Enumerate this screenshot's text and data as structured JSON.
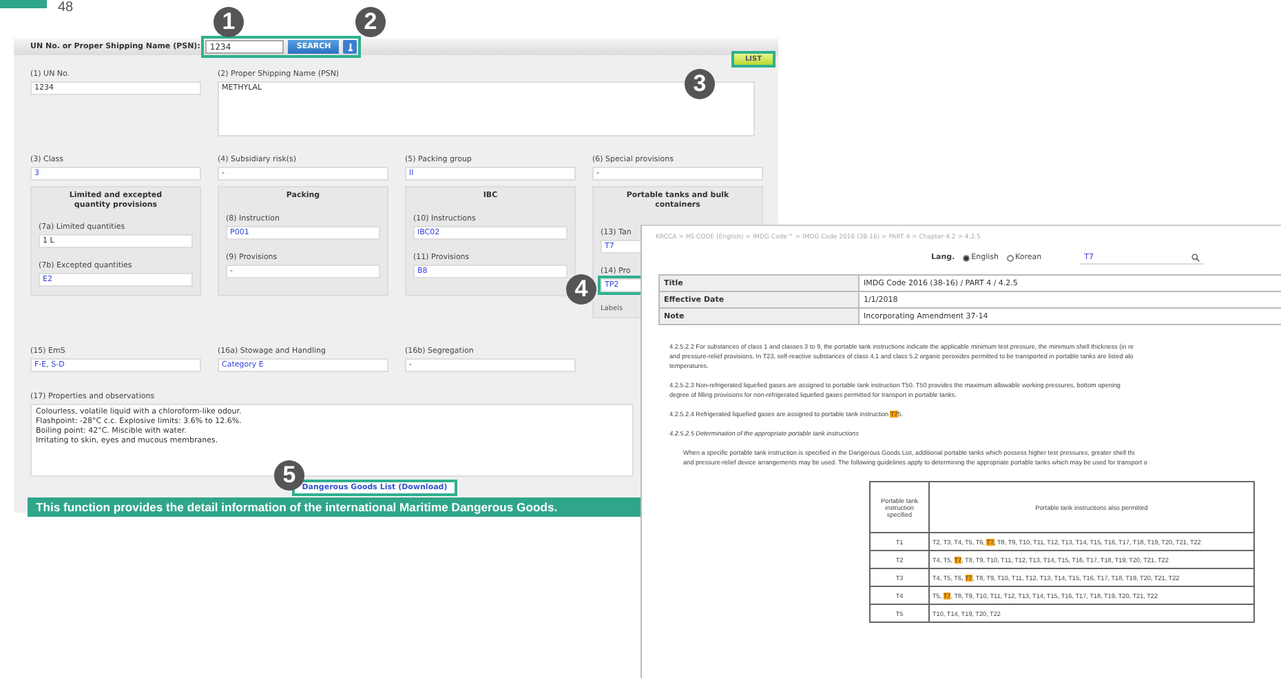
{
  "page_number": "48",
  "callouts": [
    {
      "number": "1"
    },
    {
      "number": "2"
    },
    {
      "number": "3"
    },
    {
      "number": "4"
    },
    {
      "number": "5"
    }
  ],
  "search": {
    "label": "UN No. or Proper Shipping Name (PSN):",
    "value": "1234",
    "button": "SEARCH",
    "framed": true
  },
  "list_button": {
    "label": "LIST",
    "framed": true
  },
  "un_no": {
    "label": "(1) UN No.",
    "value": "1234"
  },
  "psn": {
    "label": "(2) Proper Shipping Name (PSN)",
    "value": "METHYLAL"
  },
  "row_fields": [
    {
      "label": "(3) Class",
      "value": "3",
      "link": true
    },
    {
      "label": "(4) Subsidiary risk(s)",
      "value": "-",
      "link": false
    },
    {
      "label": "(5) Packing group",
      "value": "II",
      "link": true
    },
    {
      "label": "(6) Special provisions",
      "value": "-",
      "link": false
    }
  ],
  "groups": [
    {
      "title": "Limited and excepted quantity provisions",
      "fields": [
        {
          "label": "(7a) Limited quantities",
          "value": "1 L",
          "link": false,
          "framed": false
        },
        {
          "label": "(7b) Excepted quantities",
          "value": "E2",
          "link": true,
          "framed": false
        }
      ]
    },
    {
      "title": "Packing",
      "fields": [
        {
          "label": "(8) Instruction",
          "value": "P001",
          "link": true,
          "framed": false
        },
        {
          "label": "(9) Provisions",
          "value": "-",
          "link": false,
          "framed": false
        }
      ]
    },
    {
      "title": "IBC",
      "fields": [
        {
          "label": "(10) Instructions",
          "value": "IBC02",
          "link": true,
          "framed": false
        },
        {
          "label": "(11) Provisions",
          "value": "B8",
          "link": true,
          "framed": false
        }
      ]
    },
    {
      "title": "Portable tanks and bulk containers",
      "fields": [
        {
          "label": "(13) Tan",
          "value": "T7",
          "link": true,
          "framed": false
        },
        {
          "label": "(14) Pro",
          "value": "TP2",
          "link": true,
          "framed": true
        }
      ],
      "note": "Labels"
    }
  ],
  "bottom_fields": [
    {
      "label": "(15) EmS",
      "value": "F-E, S-D",
      "link": true
    },
    {
      "label": "(16a) Stowage and Handling",
      "value": "Category E",
      "link": true
    },
    {
      "label": "(16b) Segregation",
      "value": "-",
      "link": false
    }
  ],
  "properties": {
    "label": "(17) Properties and observations",
    "lines": [
      "Colourless, volatile liquid with a chloroform-like odour.",
      "Flashpoint: -28°C c.c. Explosive limits: 3.6% to 12.6%.",
      "Boiling point: 42°C. Miscible with water.",
      "Irritating to skin, eyes and mucous membranes."
    ]
  },
  "download_link": {
    "label": "Dangerous Goods List (Download)",
    "framed": true
  },
  "caption": "This function provides the detail information of the international Maritime Dangerous Goods.",
  "detail_window": {
    "breadcrumb": "KRCCA > HS CODE (English) > IMDG Code™ > IMDG Code 2016 (38-16) > PART 4 > Chapter 4.2 > 4.2.5",
    "lang_label": "Lang.",
    "languages": [
      {
        "label": "English",
        "selected": true
      },
      {
        "label": "Korean",
        "selected": false
      }
    ],
    "search_value": "T7",
    "info": [
      {
        "key": "Title",
        "value": "IMDG Code 2016 (38-16) / PART 4 / 4.2.5"
      },
      {
        "key": "Effective Date",
        "value": "1/1/2018"
      },
      {
        "key": "Note",
        "value": "Incorporating Amendment 37-14"
      }
    ],
    "paragraphs": [
      {
        "kind": "plain",
        "lines": [
          [
            {
              "text": "4.2.5.2.2 For substances of class 1 and classes 3 to 9, the portable tank instructions indicate the applicable minimum test pressure, the minimum shell thickness (in re",
              "highlighted": false
            }
          ],
          [
            {
              "text": "and pressure-relief provisions. In T23, self-reactive substances of class 4.1 and class 5.2 organic peroxides permitted to be transported in portable tanks are listed alo",
              "highlighted": false
            }
          ],
          [
            {
              "text": "temperatures.",
              "highlighted": false
            }
          ]
        ]
      },
      {
        "kind": "plain",
        "lines": [
          [
            {
              "text": "4.2.5.2.3 Non-refrigerated liquefied gases are assigned to portable tank instruction T50. T50 provides the maximum allowable working pressures, bottom opening",
              "highlighted": false
            }
          ],
          [
            {
              "text": "degree of filling provisions for non-refrigerated liquefied gases permitted for transport in portable tanks.",
              "highlighted": false
            }
          ]
        ]
      },
      {
        "kind": "plain",
        "lines": [
          [
            {
              "text": "4.2.5.2.4 Refrigerated liquefied gases are assigned to portable tank instruction ",
              "highlighted": false
            },
            {
              "text": "T7",
              "highlighted": true
            },
            {
              "text": "5.",
              "highlighted": false
            }
          ]
        ]
      },
      {
        "kind": "heading",
        "lines": [
          [
            {
              "text": "4.2.5.2.5 Determination of the appropriate portable tank instructions",
              "highlighted": false
            }
          ]
        ]
      },
      {
        "kind": "indented",
        "lines": [
          [
            {
              "text": "When a specific portable tank instruction is specified in the Dangerous Goods List, additional portable tanks which possess higher test pressures, greater shell thi",
              "highlighted": false
            }
          ],
          [
            {
              "text": "and pressure-relief device arrangements may be used. The following guidelines apply to determining the appropriate portable tanks which may be used for transport o",
              "highlighted": false
            }
          ]
        ]
      }
    ],
    "tank_table": {
      "columns": [
        "Portable tank instruction specified",
        "Portable tank instructions also permitted"
      ],
      "rows": [
        {
          "instruction": "T1",
          "permitted": [
            {
              "text": "T2, T3, T4, T5, T6, ",
              "highlighted": false
            },
            {
              "text": "T7",
              "highlighted": true
            },
            {
              "text": ", T8, T9, T10, T11, T12, T13, T14, T15, T16, T17, T18, T19, T20, T21, T22",
              "highlighted": false
            }
          ]
        },
        {
          "instruction": "T2",
          "permitted": [
            {
              "text": "T4, T5, ",
              "highlighted": false
            },
            {
              "text": "T7",
              "highlighted": true
            },
            {
              "text": ", T8, T9, T10, T11, T12, T13, T14, T15, T16, T17, T18, T19, T20, T21, T22",
              "highlighted": false
            }
          ]
        },
        {
          "instruction": "T3",
          "permitted": [
            {
              "text": "T4, T5, T6, ",
              "highlighted": false
            },
            {
              "text": "T7",
              "highlighted": true
            },
            {
              "text": ", T8, T9, T10, T11, T12, T13, T14, T15, T16, T17, T18, T19, T20, T21, T22",
              "highlighted": false
            }
          ]
        },
        {
          "instruction": "T4",
          "permitted": [
            {
              "text": "T5, ",
              "highlighted": false
            },
            {
              "text": "T7",
              "highlighted": true
            },
            {
              "text": ", T8, T9, T10, T11, T12, T13, T14, T15, T16, T17, T18, T19, T20, T21, T22",
              "highlighted": false
            }
          ]
        },
        {
          "instruction": "T5",
          "permitted": [
            {
              "text": "T10, T14, T19, T20, T22",
              "highlighted": false
            }
          ]
        }
      ]
    }
  }
}
